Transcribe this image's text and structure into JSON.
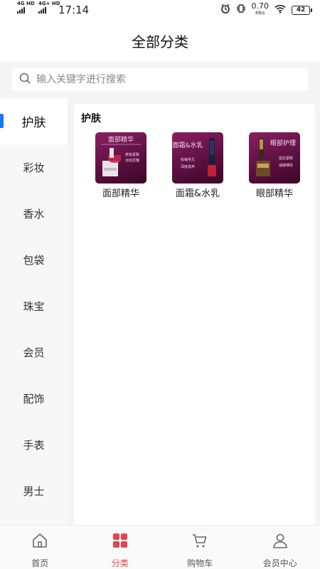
{
  "status_bar": {
    "signal_1": "4G HD",
    "signal_2": "4G+ HD",
    "time": "17:14",
    "net_speed_value": "0.70",
    "net_speed_unit": "KB/s",
    "battery": "42"
  },
  "header": {
    "title": "全部分类"
  },
  "search": {
    "placeholder": "输入关键字进行搜索",
    "value": ""
  },
  "sidebar": {
    "items": [
      {
        "label": "护肤",
        "active": true
      },
      {
        "label": "彩妆"
      },
      {
        "label": "香水"
      },
      {
        "label": "包袋"
      },
      {
        "label": "珠宝"
      },
      {
        "label": "会员"
      },
      {
        "label": "配饰"
      },
      {
        "label": "手表"
      },
      {
        "label": "男士"
      }
    ]
  },
  "panel": {
    "title": "护肤",
    "products": [
      {
        "label": "面部精华",
        "image_caption": "面部精华",
        "image_lines": [
          "修复紧致",
          "淡纹抗皱"
        ]
      },
      {
        "label": "面霜&水乳",
        "image_caption": "面霜&水乳",
        "image_lines": [
          "收缩毛孔",
          "深度滋养"
        ]
      },
      {
        "label": "眼部精华",
        "image_caption": "眼部护理",
        "image_lines": [
          "提拉紧致",
          "减缓细纹"
        ]
      }
    ]
  },
  "tabbar": {
    "items": [
      {
        "label": "首页",
        "icon": "home-icon"
      },
      {
        "label": "分类",
        "icon": "category-icon",
        "active": true
      },
      {
        "label": "购物车",
        "icon": "cart-icon"
      },
      {
        "label": "会员中心",
        "icon": "user-icon"
      }
    ]
  },
  "colors": {
    "accent_active_tab": "#e8434a",
    "sidebar_indicator": "#1677ff"
  }
}
